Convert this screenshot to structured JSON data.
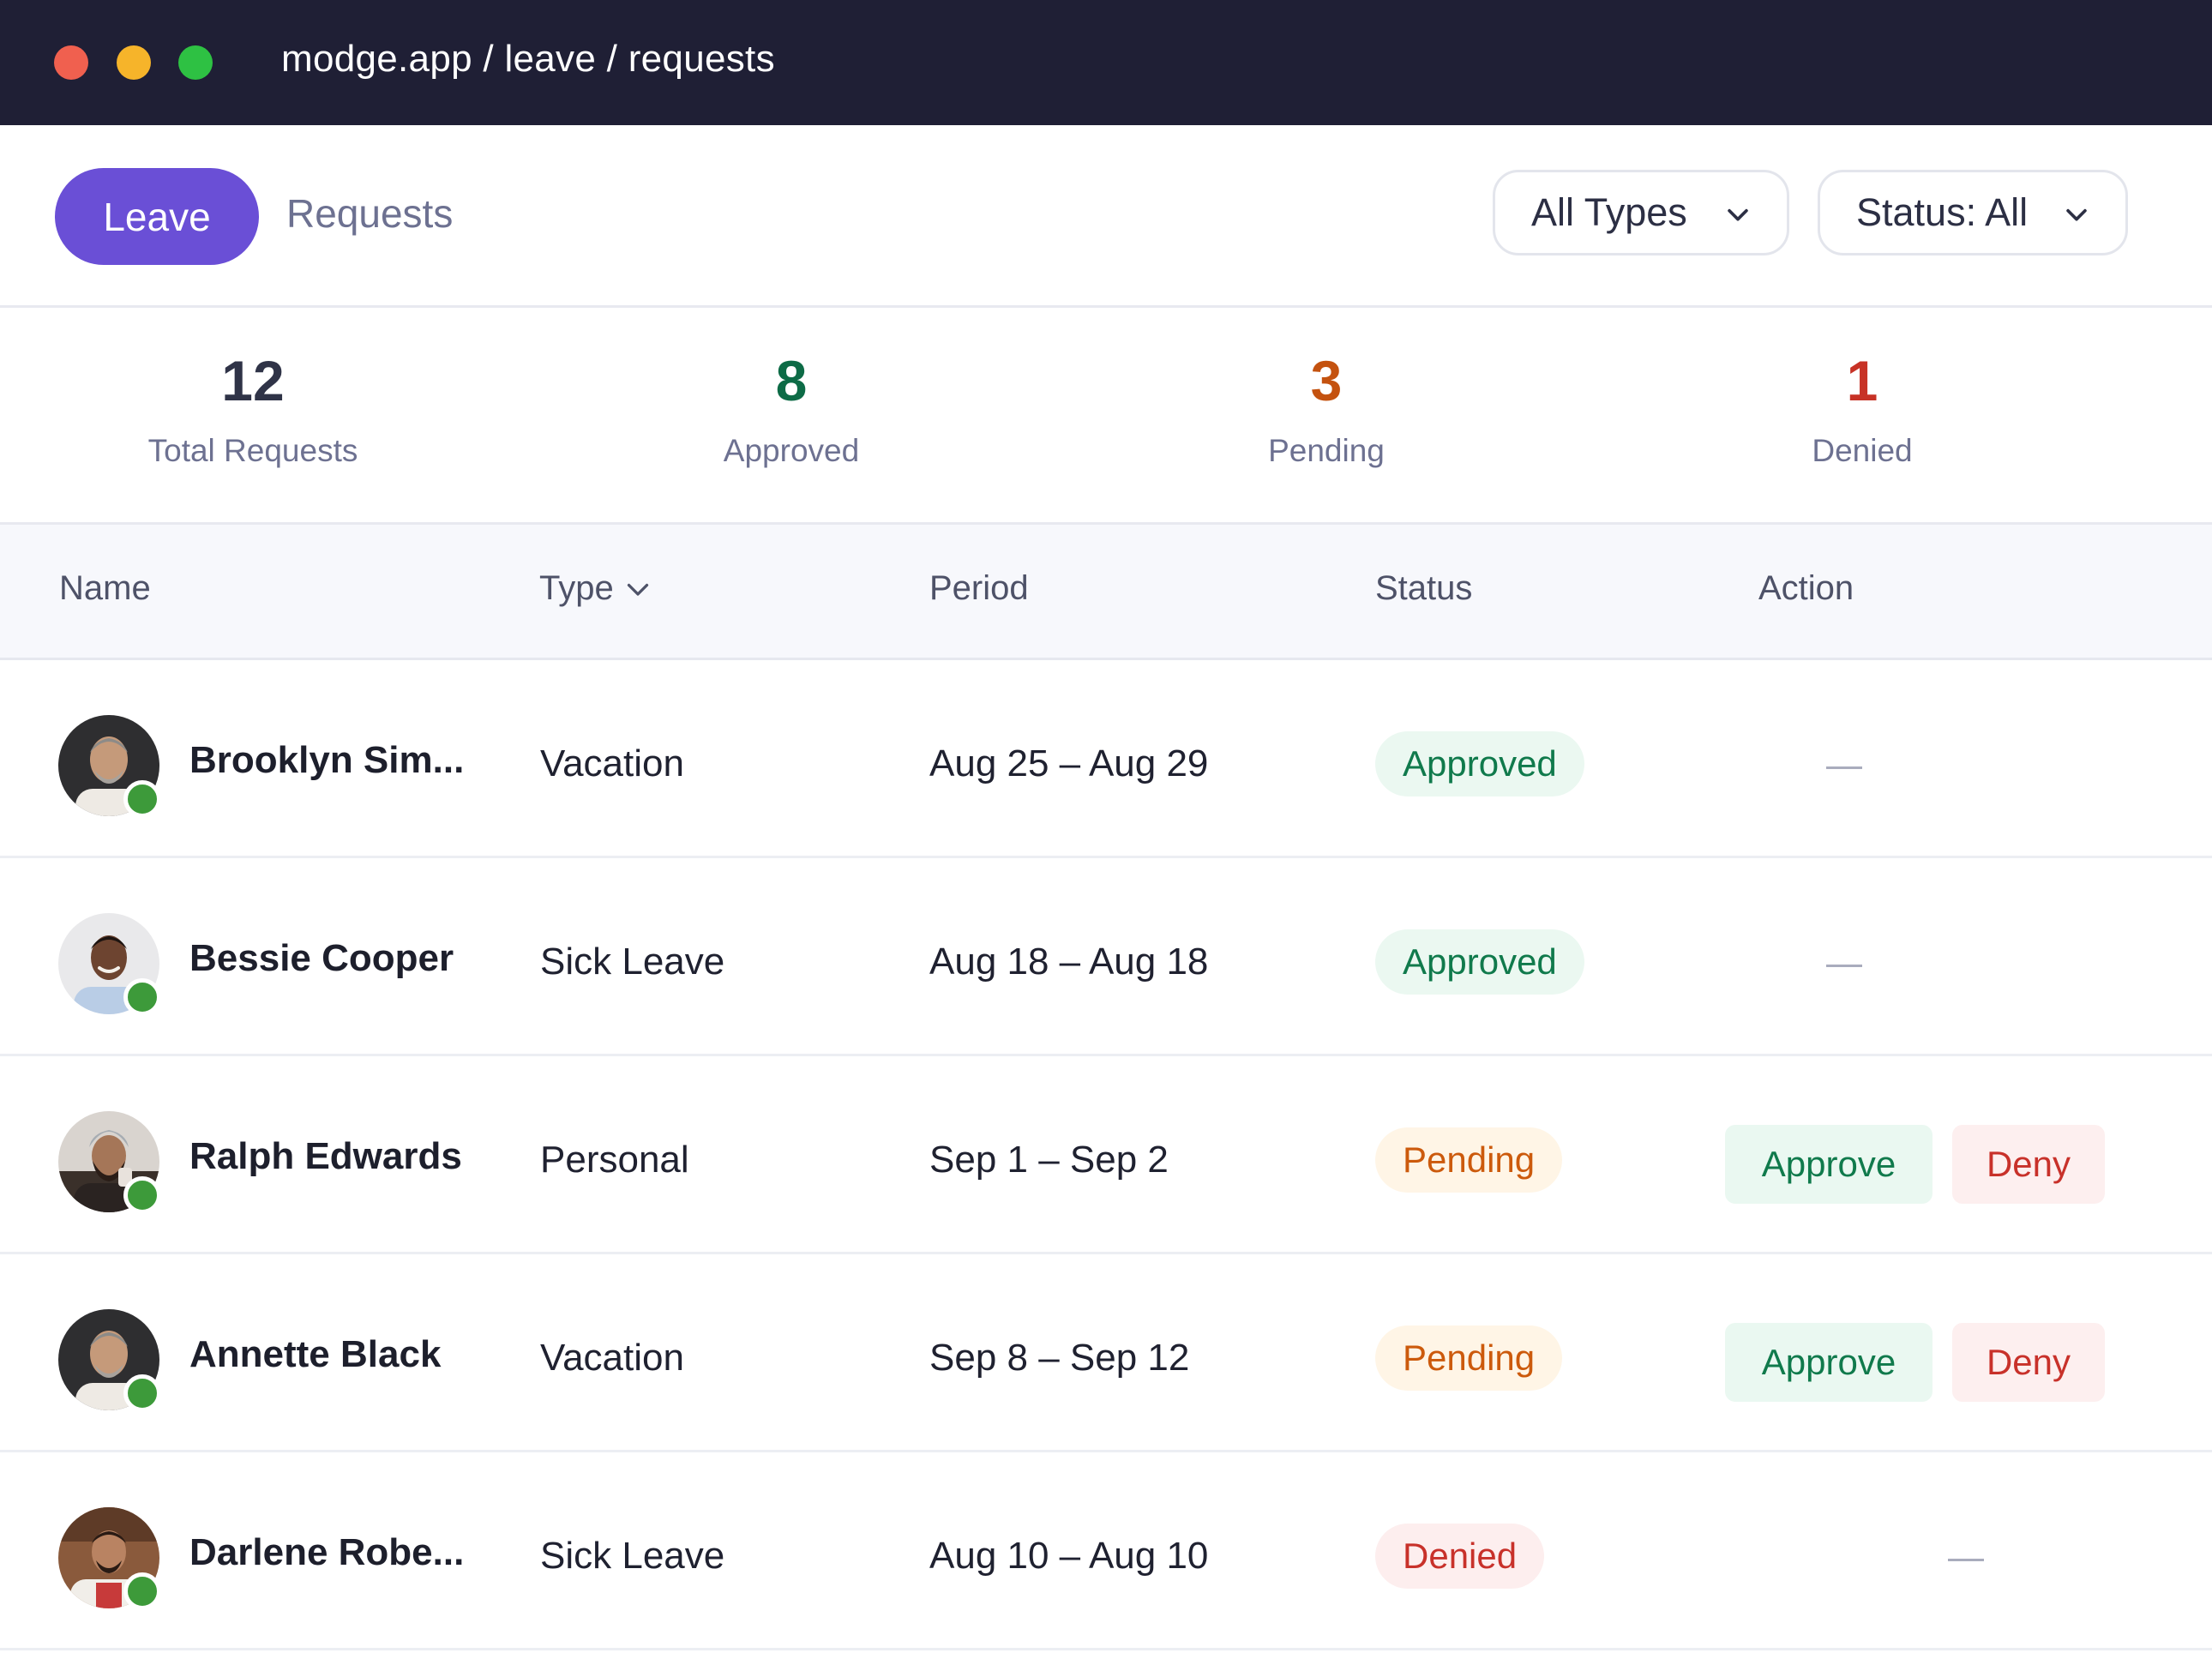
{
  "window": {
    "url": "modge.app / leave / requests"
  },
  "toolbar": {
    "primary_tab": "Leave",
    "secondary_tab": "Requests",
    "type_filter": "All Types",
    "status_filter": "Status: All"
  },
  "stats": [
    {
      "value": "12",
      "label": "Total Requests",
      "color": "#2f3347"
    },
    {
      "value": "8",
      "label": "Approved",
      "color": "#0d6b46"
    },
    {
      "value": "3",
      "label": "Pending",
      "color": "#c4520f"
    },
    {
      "value": "1",
      "label": "Denied",
      "color": "#c73226"
    }
  ],
  "table": {
    "columns": [
      "Name",
      "Type",
      "Period",
      "Status",
      "Action"
    ],
    "rows": [
      {
        "name": "Brooklyn Sim...",
        "type": "Vacation",
        "period": "Aug 25 – Aug 29",
        "status": "Approved",
        "online": true
      },
      {
        "name": "Bessie Cooper",
        "type": "Sick Leave",
        "period": "Aug 18 – Aug 18",
        "status": "Approved",
        "online": true
      },
      {
        "name": "Ralph Edwards",
        "type": "Personal",
        "period": "Sep 1 – Sep 2",
        "status": "Pending",
        "online": true
      },
      {
        "name": "Annette Black",
        "type": "Vacation",
        "period": "Sep 8 – Sep 12",
        "status": "Pending",
        "online": true
      },
      {
        "name": "Darlene Robe...",
        "type": "Sick Leave",
        "period": "Aug 10 – Aug 10",
        "status": "Denied",
        "online": true
      }
    ],
    "actions": {
      "approve": "Approve",
      "deny": "Deny"
    }
  },
  "colors": {
    "accent": "#6a4fd6",
    "titlebar": "#1f1f35",
    "approved": "#107a4c",
    "pending": "#cc5a0c",
    "denied": "#c8312a",
    "online": "#3d9a3a"
  },
  "icons": {
    "window_controls": [
      "close-dot",
      "minimize-dot",
      "maximize-dot"
    ],
    "dropdown": "chevron-down-icon",
    "sort": "chevron-down-icon",
    "presence": "online-status-dot"
  }
}
